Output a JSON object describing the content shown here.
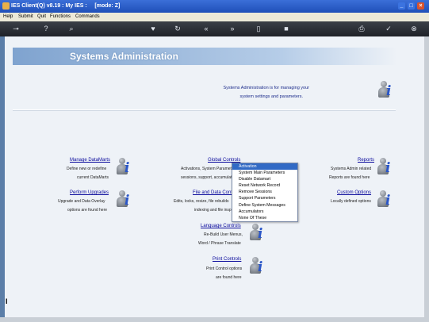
{
  "window": {
    "title": "IES Client(Q) v8.19 : My IES :     [mode: Z]"
  },
  "menubar": [
    "Help",
    "Submit",
    "Quit",
    "Functions",
    "Commands"
  ],
  "page": {
    "banner": "Systems Administration",
    "intro": [
      "Systems Administration is for managing your",
      "system settings and parameters."
    ]
  },
  "sections": {
    "manage_datamarts": {
      "link": "Manage DataMarts",
      "desc": [
        "Define new or redefine",
        "current DataMarts"
      ]
    },
    "perform_upgrades": {
      "link": "Perform Upgrades",
      "desc": [
        "Upgrade and Data Overlay",
        "options are found here"
      ]
    },
    "global_controls": {
      "link": "Global Controls",
      "desc": [
        "Activations, System Parameters",
        "sessions, support, accumulators"
      ]
    },
    "file_data_controls": {
      "link": "File and Data Controls",
      "desc": [
        "Edits, locks, resize, file rebuilds",
        "indexing and file inspections"
      ]
    },
    "language_controls": {
      "link": "Language Controls",
      "desc": [
        "Re-Build User Menus,",
        "Word / Phrase Translate"
      ]
    },
    "print_controls": {
      "link": "Print Controls",
      "desc": [
        "Print Control options",
        "are found here"
      ]
    },
    "reports": {
      "link": "Reports",
      "desc": [
        "Systems Admin related",
        "Reports are found here"
      ]
    },
    "custom_options": {
      "link": "Custom Options",
      "desc": [
        "Locally defined options"
      ]
    }
  },
  "context_menu": {
    "items": [
      "Activation",
      "System Main Parameters",
      "Disable Datamart",
      "Reset Network Record",
      "Remove Sessions",
      "Support Parameters",
      "Define System Messages",
      "Accumulators",
      "None Of These"
    ],
    "selected": "Activation"
  },
  "colors": {
    "titlebar": "#1f4fb8",
    "selection": "#316ac5",
    "link": "#0a0a9c"
  }
}
